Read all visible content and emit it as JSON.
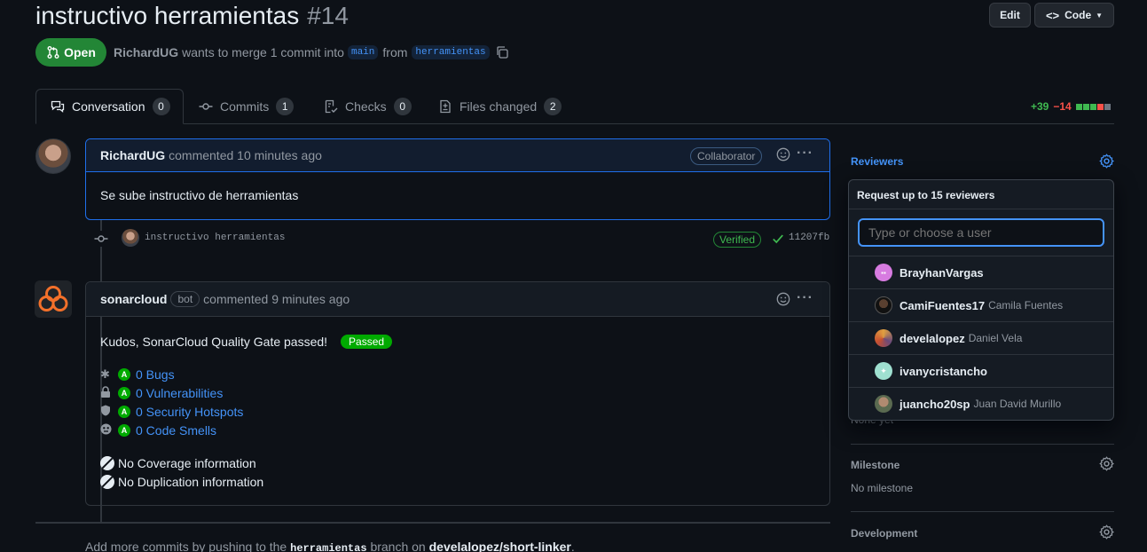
{
  "pr": {
    "title": "instructivo herramientas",
    "number": "#14",
    "state": "Open",
    "author": "RichardUG",
    "merge_text_1": "wants to merge 1 commit into",
    "base_branch": "main",
    "from_text": "from",
    "head_branch": "herramientas"
  },
  "header_buttons": {
    "edit": "Edit",
    "code": "Code"
  },
  "tabs": [
    {
      "label": "Conversation",
      "count": "0"
    },
    {
      "label": "Commits",
      "count": "1"
    },
    {
      "label": "Checks",
      "count": "0"
    },
    {
      "label": "Files changed",
      "count": "2"
    }
  ],
  "diffstat": {
    "additions": "+39",
    "deletions": "−14"
  },
  "comment1": {
    "author": "RichardUG",
    "meta": "commented 10 minutes ago",
    "badge": "Collaborator",
    "body": "Se sube instructivo de herramientas"
  },
  "commit": {
    "message": "instructivo herramientas",
    "verified": "Verified",
    "sha": "11207fb"
  },
  "comment2": {
    "author": "sonarcloud",
    "bot_badge": "bot",
    "meta": "commented 9 minutes ago",
    "intro": "Kudos, SonarCloud Quality Gate passed!",
    "passed": "Passed",
    "grade": "A",
    "metrics": [
      "0 Bugs",
      "0 Vulnerabilities",
      "0 Security Hotspots",
      "0 Code Smells"
    ],
    "coverage": [
      "No Coverage information",
      "No Duplication information"
    ]
  },
  "footer_text": {
    "prefix": "Add more commits by pushing to the",
    "branch": "herramientas",
    "middle": "branch on",
    "repo": "develalopez/short-linker",
    "suffix": "."
  },
  "sidebar": {
    "reviewers_label": "Reviewers",
    "none_yet": "None yet",
    "milestone_label": "Milestone",
    "milestone_value": "No milestone",
    "development_label": "Development"
  },
  "reviewer_popup": {
    "title": "Request up to 15 reviewers",
    "placeholder": "Type or choose a user",
    "users": [
      {
        "login": "BrayhanVargas",
        "name": ""
      },
      {
        "login": "CamiFuentes17",
        "name": "Camila Fuentes"
      },
      {
        "login": "develalopez",
        "name": "Daniel Vela"
      },
      {
        "login": "ivanycristancho",
        "name": ""
      },
      {
        "login": "juancho20sp",
        "name": "Juan David Murillo"
      }
    ]
  },
  "colors": {
    "open_green": "#238636",
    "link_blue": "#4493f8",
    "add_green": "#3fb950",
    "del_red": "#f85149",
    "sonar_orange": "#f3702a"
  }
}
